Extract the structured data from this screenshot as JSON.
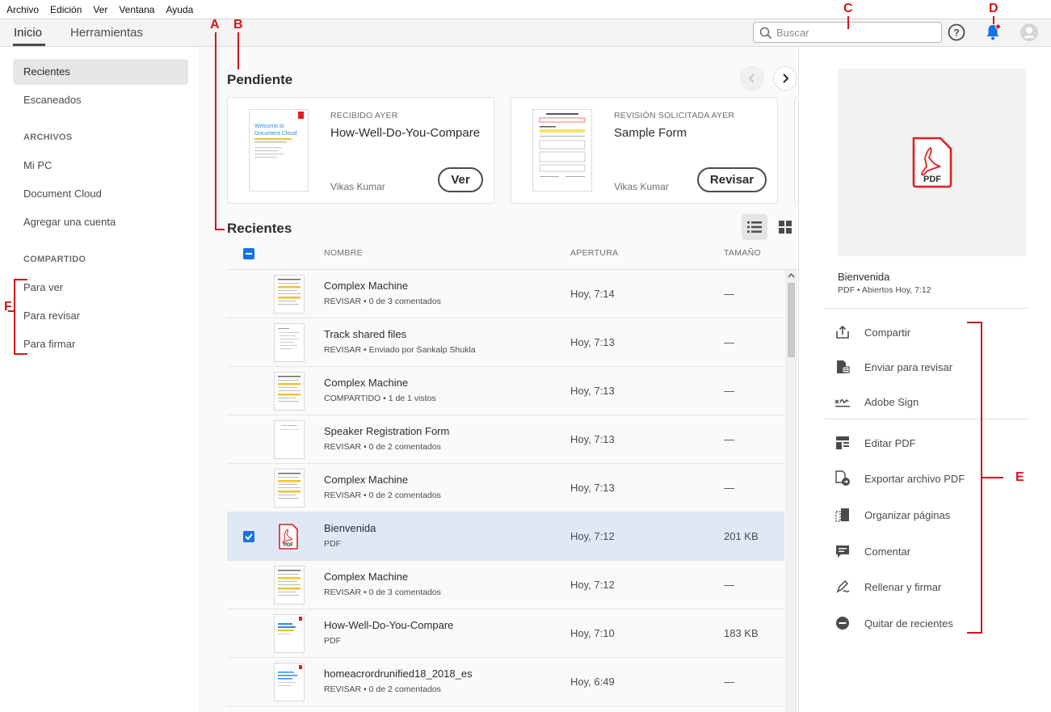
{
  "menubar": {
    "items": [
      "Archivo",
      "Edición",
      "Ver",
      "Ventana",
      "Ayuda"
    ]
  },
  "topbar": {
    "tab_home": "Inicio",
    "tab_tools": "Herramientas",
    "search_placeholder": "Buscar",
    "icons": [
      "search-icon",
      "help-icon",
      "bell-icon",
      "user-avatar-icon"
    ]
  },
  "sidebar": {
    "recent": "Recientes",
    "scanned": "Escaneados",
    "files_header": "ARCHIVOS",
    "my_pc": "Mi PC",
    "document_cloud": "Document Cloud",
    "add_account": "Agregar una cuenta",
    "shared_header": "COMPARTIDO",
    "to_view": "Para ver",
    "to_review": "Para revisar",
    "to_sign": "Para firmar"
  },
  "pending": {
    "title": "Pendiente",
    "cards": [
      {
        "meta": "RECIBIDO AYER",
        "title": "How-Well-Do-You-Compare",
        "sender": "Vikas Kumar",
        "button": "Ver"
      },
      {
        "meta": "REVISIÓN SOLICITADA AYER",
        "title": "Sample Form",
        "sender": "Vikas Kumar",
        "button": "Revisar"
      }
    ]
  },
  "recent": {
    "title": "Recientes",
    "columns": {
      "name": "NOMBRE",
      "opened": "APERTURA",
      "size": "TAMAÑO"
    },
    "rows": [
      {
        "name": "Complex Machine",
        "sub": "REVISAR  •  0 de 3 comentados",
        "opened": "Hoy, 7:14",
        "size": "—"
      },
      {
        "name": "Track shared files",
        "sub": "REVISAR  •  Enviado por Sankalp Shukla",
        "opened": "Hoy, 7:13",
        "size": "—"
      },
      {
        "name": "Complex Machine",
        "sub": "COMPARTIDO  •  1 de 1 vistos",
        "opened": "Hoy, 7:13",
        "size": "—"
      },
      {
        "name": "Speaker Registration Form",
        "sub": "REVISAR  •  0 de 2 comentados",
        "opened": "Hoy, 7:13",
        "size": "—"
      },
      {
        "name": "Complex Machine",
        "sub": "REVISAR  •  0 de 2 comentados",
        "opened": "Hoy, 7:13",
        "size": "—"
      },
      {
        "name": "Bienvenida",
        "sub": "PDF",
        "opened": "Hoy, 7:12",
        "size": "201 KB"
      },
      {
        "name": "Complex Machine",
        "sub": "REVISAR  •  0 de 3 comentados",
        "opened": "Hoy, 7:12",
        "size": "—"
      },
      {
        "name": "How-Well-Do-You-Compare",
        "sub": "PDF",
        "opened": "Hoy, 7:10",
        "size": "183 KB"
      },
      {
        "name": "homeacrordrunified18_2018_es",
        "sub": "REVISAR  •  0 de 2 comentados",
        "opened": "Hoy, 6:49",
        "size": "—"
      }
    ]
  },
  "right_panel": {
    "doc_name": "Bienvenida",
    "doc_meta": "PDF  •  Abiertos Hoy, 7:12",
    "pdf_label": "PDF",
    "actions": {
      "share": "Compartir",
      "send_review": "Enviar para revisar",
      "adobe_sign": "Adobe Sign",
      "edit_pdf": "Editar PDF",
      "export_pdf": "Exportar archivo PDF",
      "organize": "Organizar páginas",
      "comment": "Comentar",
      "fill_sign": "Rellenar y firmar",
      "remove_recent": "Quitar de recientes"
    }
  },
  "annotations": {
    "a": "A",
    "b": "B",
    "c": "C",
    "d": "D",
    "e": "E",
    "f": "F"
  },
  "colors": {
    "accent_blue": "#1473e6",
    "adobe_red": "#e01e1e",
    "annotation_red": "#d0151c"
  }
}
